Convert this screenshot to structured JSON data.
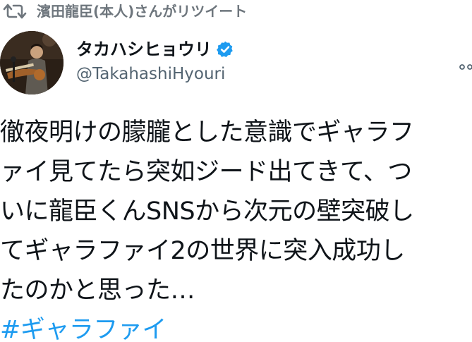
{
  "retweet": {
    "text": "濱田龍臣(本人)さんがリツイート"
  },
  "author": {
    "name": "タカハシヒョウリ",
    "handle": "@TakahashiHyouri"
  },
  "tweet": {
    "lines": [
      "徹夜明けの朦朧とした意識でギャラフ",
      "ァイ見てたら突如ジード出てきて、つ",
      "いに龍臣くんSNSから次元の壁突破し",
      "てギャラファイ2の世界に突入成功し",
      "たのかと思った…"
    ],
    "hashtag": "#ギャラファイ"
  },
  "colors": {
    "text": "#0f1419",
    "secondary": "#536471",
    "retweet_label": "#6e767d",
    "accent": "#1d9bf0"
  },
  "icons": {
    "retweet": "retweet-icon",
    "verified": "verified-badge-icon",
    "more": "more-options-icon"
  }
}
